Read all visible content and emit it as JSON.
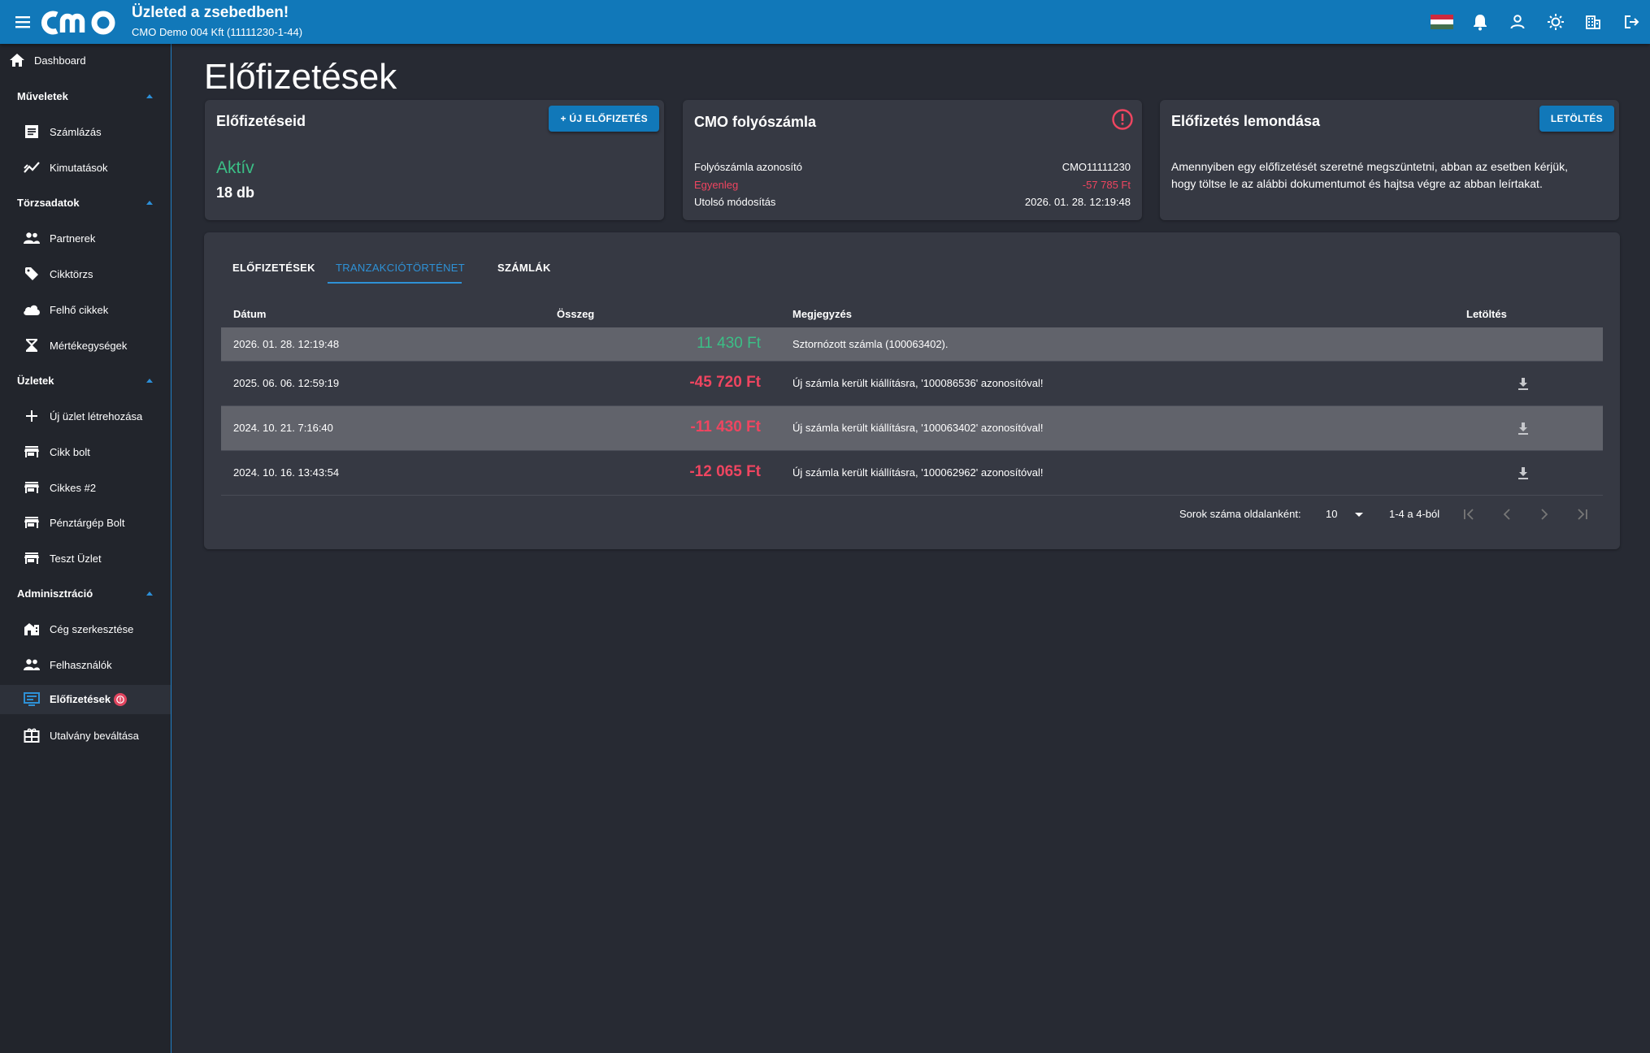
{
  "header": {
    "title": "Üzleted a zsebedben!",
    "company": "CMO Demo 004 Kft (11111230-1-44)",
    "icons": [
      "menu-icon",
      "cmo-logo",
      "hungarian-flag-icon",
      "bell-icon",
      "user-icon",
      "brightness-icon",
      "building-icon",
      "logout-icon"
    ],
    "brand_color": "#1178b9"
  },
  "sidebar": {
    "dashboard": "Dashboard",
    "sections": {
      "muveletek": "Műveletek",
      "torzsadatok": "Törzsadatok",
      "uzletek": "Üzletek",
      "adminisztracio": "Adminisztráció"
    },
    "items": {
      "szamlazas": "Számlázás",
      "kimutatasok": "Kimutatások",
      "partnerek": "Partnerek",
      "cikktorzs": "Cikktörzs",
      "felho_cikkek": "Felhő cikkek",
      "mertekegysegek": "Mértékegységek",
      "uj_uzlet": "Új üzlet létrehozása",
      "cikk_bolt": "Cikk bolt",
      "cikkes2": "Cikkes #2",
      "penztargep_bolt": "Pénztárgép Bolt",
      "teszt_uzlet": "Teszt Üzlet",
      "ceg_szerkesztese": "Cég szerkesztése",
      "felhasznalok": "Felhasználók",
      "elofizetesek": "Előfizetések",
      "utalvany": "Utalvány beváltása"
    },
    "active": "Előfizetések"
  },
  "page": {
    "title": "Előfizetések"
  },
  "cards": {
    "subscriptions": {
      "title": "Előfizetéseid",
      "new_button": "+ ÚJ ELŐFIZETÉS",
      "status": "Aktív",
      "count": "18 db"
    },
    "account": {
      "title": "CMO folyószámla",
      "id_label": "Folyószámla azonosító",
      "id_value": "CMO11111230",
      "balance_label": "Egyenleg",
      "balance_value": "-57 785 Ft",
      "modified_label": "Utolsó módosítás",
      "modified_value": "2026. 01. 28. 12:19:48"
    },
    "cancel": {
      "title": "Előfizetés lemondása",
      "download_button": "LETÖLTÉS",
      "text": "Amennyiben egy előfizetését szeretné megszüntetni, abban az esetben kérjük, hogy töltse le az alábbi dokumentumot és hajtsa végre az abban leírtakat."
    }
  },
  "tabs": {
    "elofizetesek": "ELŐFIZETÉSEK",
    "tranzakciok": "TRANZAKCIÓTÖRTÉNET",
    "szamlak": "SZÁMLÁK",
    "active": "TRANZAKCIÓTÖRTÉNET"
  },
  "table": {
    "columns": {
      "date": "Dátum",
      "amount": "Összeg",
      "note": "Megjegyzés",
      "download": "Letöltés"
    },
    "rows": [
      {
        "date": "2026. 01. 28. 12:19:48",
        "amount": "11 430 Ft",
        "note": "Sztornózott számla (100063402).",
        "downloadable": false
      },
      {
        "date": "2025. 06. 06. 12:59:19",
        "amount": "-45 720 Ft",
        "note": "Új számla került kiállításra, '100086536' azonosítóval!",
        "downloadable": true
      },
      {
        "date": "2024. 10. 21. 7:16:40",
        "amount": "-11 430 Ft",
        "note": "Új számla került kiállításra, '100063402' azonosítóval!",
        "downloadable": true
      },
      {
        "date": "2024. 10. 16. 13:43:54",
        "amount": "-12 065 Ft",
        "note": "Új számla került kiállításra, '100062962' azonosítóval!",
        "downloadable": true
      }
    ],
    "footer": {
      "rows_per_page_label": "Sorok száma oldalanként:",
      "rows_per_page": "10",
      "range": "1-4 a 4-ból"
    }
  },
  "colors": {
    "positive": "#3bbf86",
    "negative": "#ef4560",
    "accent": "#2e91d6"
  }
}
